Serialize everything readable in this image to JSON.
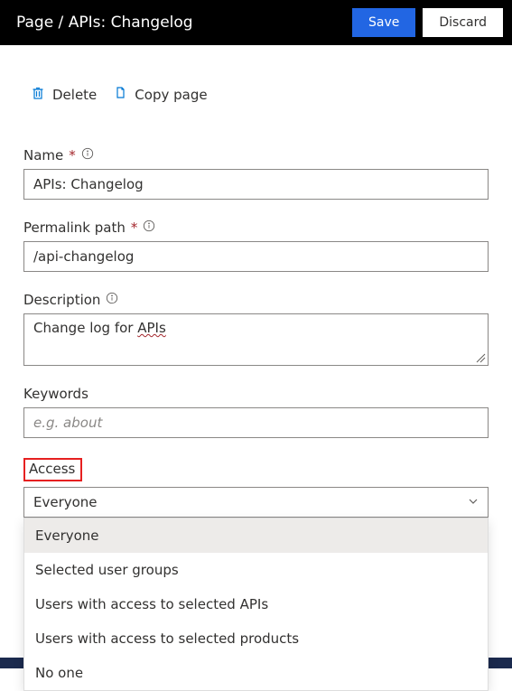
{
  "header": {
    "title": "Page / APIs: Changelog",
    "save_label": "Save",
    "discard_label": "Discard"
  },
  "toolbar": {
    "delete_label": "Delete",
    "copy_label": "Copy page"
  },
  "fields": {
    "name": {
      "label": "Name",
      "value": "APIs: Changelog"
    },
    "permalink": {
      "label": "Permalink path",
      "value": "/api-changelog"
    },
    "description": {
      "label": "Description",
      "prefix": "Change log for ",
      "underlined": "APIs"
    },
    "keywords": {
      "label": "Keywords",
      "placeholder": "e.g. about",
      "value": ""
    },
    "access": {
      "label": "Access",
      "selected": "Everyone",
      "options": [
        "Everyone",
        "Selected user groups",
        "Users with access to selected APIs",
        "Users with access to selected products",
        "No one"
      ]
    }
  }
}
